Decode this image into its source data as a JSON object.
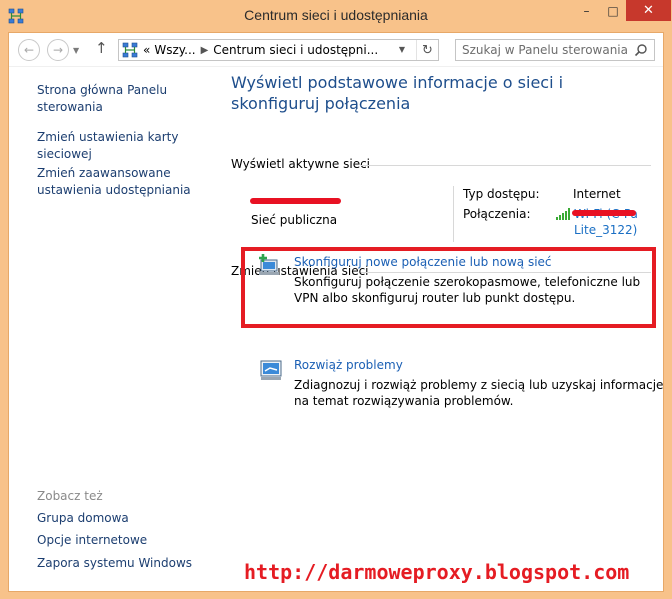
{
  "window": {
    "title": "Centrum sieci i udostępniania",
    "controls": {
      "minimize": "–",
      "maximize": "□",
      "close": "✕"
    }
  },
  "address": {
    "back": "←",
    "forward": "→",
    "up": "↑",
    "crumb_overflow": "«",
    "crumb1": "Wszy...",
    "crumb2": "Centrum sieci i udostępni...",
    "refresh": "↻",
    "search_placeholder": "Szukaj w Panelu sterowania"
  },
  "sidebar": {
    "items": [
      {
        "label": "Strona główna Panelu sterowania"
      },
      {
        "label": "Zmień ustawienia karty sieciowej"
      },
      {
        "label": "Zmień zaawansowane ustawienia udostępniania"
      }
    ],
    "see_also_label": "Zobacz też",
    "see_also": [
      {
        "label": "Grupa domowa"
      },
      {
        "label": "Opcje internetowe"
      },
      {
        "label": "Zapora systemu Windows"
      }
    ]
  },
  "main": {
    "heading": "Wyświetl podstawowe informacje o sieci i skonfiguruj połączenia",
    "active_networks_label": "Wyświetl aktywne sieci",
    "network_type": "Sieć publiczna",
    "access_type_label": "Typ dostępu:",
    "access_type_value": "Internet",
    "connections_label": "Połączenia:",
    "connection_name_line1": "Wi-Fi (C-Pa",
    "connection_name_line2": "Lite_3122)",
    "change_settings_label": "Zmień ustawienia sieci",
    "tasks": [
      {
        "title": "Skonfiguruj nowe połączenie lub nową sieć",
        "description": "Skonfiguruj połączenie szerokopasmowe, telefoniczne lub VPN albo skonfiguruj router lub punkt dostępu."
      },
      {
        "title": "Rozwiąż problemy",
        "description": "Zdiagnozuj i rozwiąż problemy z siecią lub uzyskaj informacje na temat rozwiązywania problemów."
      }
    ]
  },
  "watermark": "http://darmoweproxy.blogspot.com",
  "colors": {
    "frame": "#f8c28a",
    "link": "#1a5fb4",
    "heading": "#1e4e8c",
    "highlight": "#e51c23",
    "close_button": "#c7382c"
  }
}
